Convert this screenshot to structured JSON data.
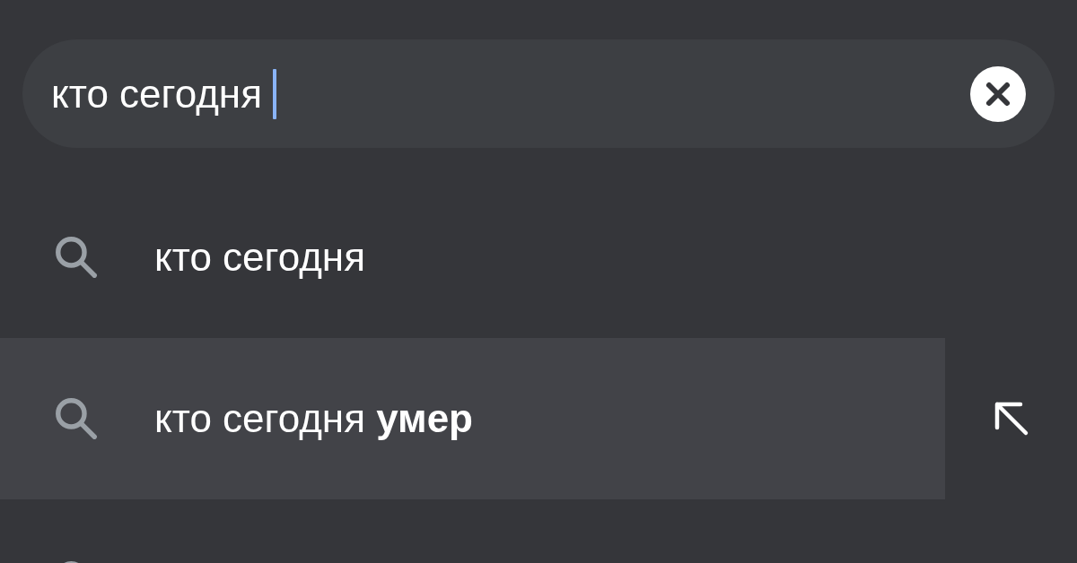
{
  "search": {
    "value": "кто сегодня "
  },
  "suggestions": [
    {
      "text": "кто сегодня",
      "selected": false
    },
    {
      "text": "кто сегодня **умер**",
      "selected": true
    },
    {
      "selected": false
    }
  ]
}
